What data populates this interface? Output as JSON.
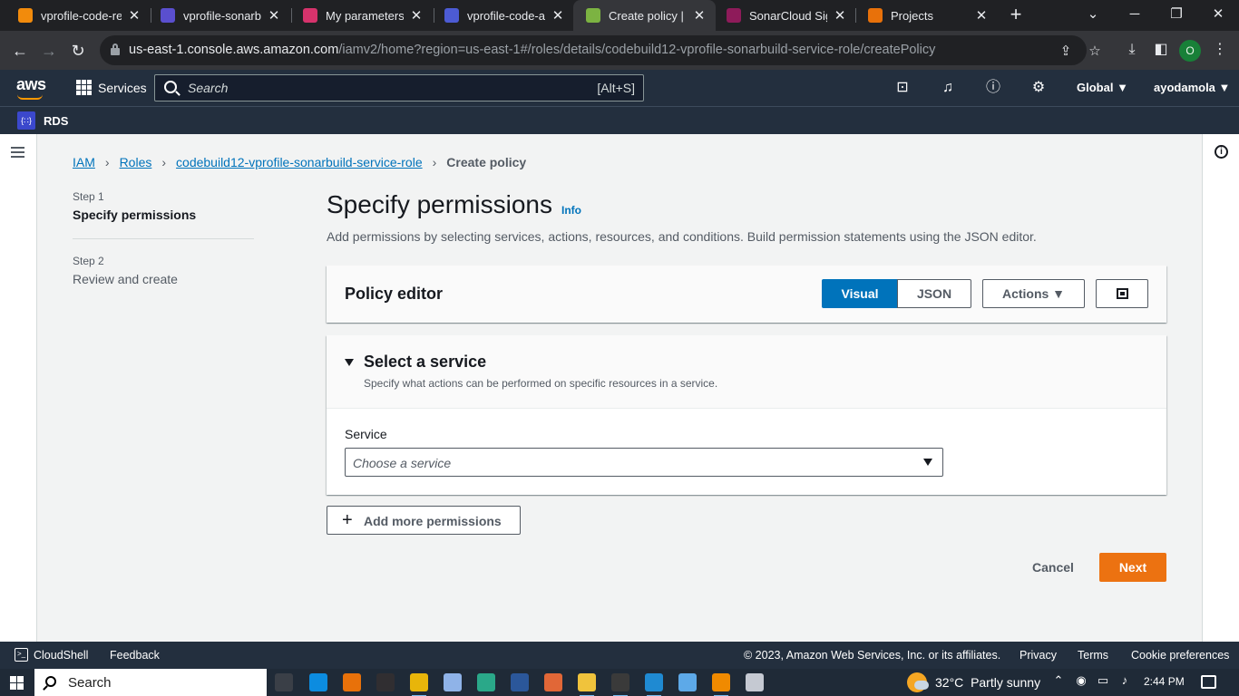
{
  "browser": {
    "tabs": [
      {
        "title": "vprofile-code-re",
        "color": "#f28b0c",
        "active": false
      },
      {
        "title": "vprofile-sonarbu",
        "color": "#5a4fcf",
        "active": false
      },
      {
        "title": "My parameters -",
        "color": "#d6336c",
        "active": false
      },
      {
        "title": "vprofile-code-ar",
        "color": "#4c5bd4",
        "active": false
      },
      {
        "title": "Create policy | I/",
        "color": "#7cb342",
        "active": true
      },
      {
        "title": "SonarCloud Sign",
        "color": "#8e1b5a",
        "active": false
      },
      {
        "title": "Projects",
        "color": "#e8710a",
        "active": false
      }
    ],
    "tab_close_glyph": "✕",
    "new_tab_glyph": "+",
    "url_host": "us-east-1.console.aws.amazon.com",
    "url_path": "/iamv2/home?region=us-east-1#/roles/details/codebuild12-vprofile-sonarbuild-service-role/createPolicy",
    "profile_initial": "O"
  },
  "aws_nav": {
    "logo": "aws",
    "services_label": "Services",
    "search_placeholder": "Search",
    "search_shortcut": "[Alt+S]",
    "region": "Global",
    "user": "ayodamola",
    "favorite": "RDS",
    "favorite_icon_text": "{∷}"
  },
  "breadcrumb": {
    "items": [
      "IAM",
      "Roles",
      "codebuild12-vprofile-sonarbuild-service-role"
    ],
    "current": "Create policy",
    "separator": "›"
  },
  "steps": [
    {
      "label": "Step 1",
      "title": "Specify permissions",
      "active": true
    },
    {
      "label": "Step 2",
      "title": "Review and create",
      "active": false
    }
  ],
  "page": {
    "title": "Specify permissions",
    "info_link": "Info",
    "description": "Add permissions by selecting services, actions, resources, and conditions. Build permission statements using the JSON editor."
  },
  "policy_editor": {
    "title": "Policy editor",
    "tab_visual": "Visual",
    "tab_json": "JSON",
    "selected_tab": "Visual",
    "actions_label": "Actions ▼"
  },
  "select_service": {
    "title": "Select a service",
    "subtitle": "Specify what actions can be performed on specific resources in a service.",
    "field_label": "Service",
    "placeholder": "Choose a service"
  },
  "buttons": {
    "add_more": "Add more permissions",
    "cancel": "Cancel",
    "next": "Next"
  },
  "footer": {
    "cloudshell": "CloudShell",
    "feedback": "Feedback",
    "copyright": "© 2023, Amazon Web Services, Inc. or its affiliates.",
    "privacy": "Privacy",
    "terms": "Terms",
    "cookies": "Cookie preferences"
  },
  "taskbar": {
    "search": "Search",
    "weather_temp": "32°C",
    "weather_desc": "Partly sunny",
    "time": "2:44 PM",
    "apps": [
      {
        "name": "task-view",
        "color": "#3a3f47"
      },
      {
        "name": "edge",
        "color": "#0c8ce0"
      },
      {
        "name": "firefox",
        "color": "#e8710a"
      },
      {
        "name": "obs",
        "color": "#302e31"
      },
      {
        "name": "chrome",
        "color": "#e8b50a"
      },
      {
        "name": "dropbox",
        "color": "#8fb3e8"
      },
      {
        "name": "infinity",
        "color": "#2aa889"
      },
      {
        "name": "word",
        "color": "#2b579a"
      },
      {
        "name": "matlab",
        "color": "#e16737"
      },
      {
        "name": "file-explorer",
        "color": "#f0c33c"
      },
      {
        "name": "terminal",
        "color": "#3a3a3a"
      },
      {
        "name": "vscode",
        "color": "#1f8ad2"
      },
      {
        "name": "notepad",
        "color": "#5da9e8"
      },
      {
        "name": "vlc",
        "color": "#f08a00"
      },
      {
        "name": "paint",
        "color": "#c5c9d2"
      }
    ]
  }
}
